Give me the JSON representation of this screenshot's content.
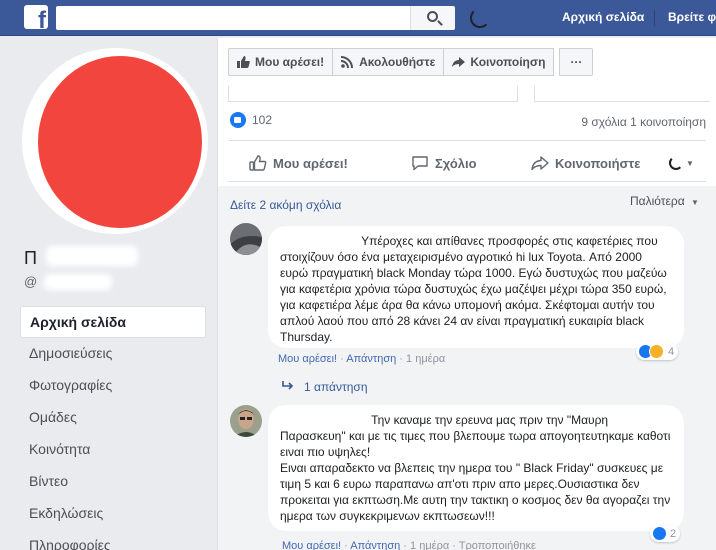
{
  "topbar": {
    "logo": "f",
    "nav_home": "Αρχική σελίδα",
    "nav_find": "Βρείτε φίλους",
    "colors": {
      "bar": "#3b5998",
      "accent": "#4267b2"
    },
    "icons": {
      "search": "search-icon",
      "logo": "facebook-logo-icon"
    }
  },
  "profile": {
    "name": "Π",
    "handle": "@",
    "avatar_color": "#f2453d"
  },
  "sidebar": {
    "items": [
      {
        "label": "Αρχική σελίδα",
        "active": true
      },
      {
        "label": "Δημοσιεύσεις"
      },
      {
        "label": "Φωτογραφίες"
      },
      {
        "label": "Ομάδες"
      },
      {
        "label": "Κοινότητα"
      },
      {
        "label": "Βίντεο"
      },
      {
        "label": "Εκδηλώσεις"
      },
      {
        "label": "Πληροφορίες"
      }
    ]
  },
  "page_actions": {
    "like": "Μου αρέσει!",
    "follow": "Ακολουθήστε",
    "share": "Κοινοποίηση",
    "more": "···"
  },
  "post": {
    "likes": "102",
    "stats": "9 σχόλια  1 κοινοποίηση",
    "like_btn": "Μου αρέσει!",
    "comment_btn": "Σχόλιο",
    "share_btn": "Κοινοποιήστε"
  },
  "comments_section": {
    "more_comments": "Δείτε 2 ακόμη σχόλια",
    "sort": "Παλιότερα",
    "reply_link": "1 απάντηση"
  },
  "comments": [
    {
      "text": "Υπέροχες και απίθανες προσφορές στις καφετέριες που στοιχίζουν όσο ένα μεταχειρισμένο αγροτικό hi lux Toyota. Από 2000 ευρώ πραγματική black Monday τώρα 1000. Εγώ δυστυχώς που μαζεύω για καφετέρια χρόνια τώρα δυστυχώς έχω μαζέψει μέχρι τώρα 350 ευρώ, για καφετιέρα λέμε άρα θα κάνω υπομονή ακόμα. Σκέφτομαι αυτήν του απλού λαού που από 28 κάνει 24 αν είναι πραγματική ευκαιρία black Thursday.",
      "like": "Μου αρέσει!",
      "reply": "Απάντηση",
      "time": "1 ημέρα",
      "reactions": "4"
    },
    {
      "text": "Την καναμε την ερευνα μας πριν την \"Μαυρη Παρασκευη\" και με τις τιμες που βλεπουμε τωρα απογοητευτηκαμε καθοτι ειναι πιο υψηλες!\nΕιναι απαραδεκτο να βλεπεις την ημερα του \" Black Friday\" συσκευες με τιμη 5 και 6 ευρω παραπανω απ'οτι πριν απο μερες.Ουσιαστικα δεν προκειται για εκπτωση.Με αυτη την τακτικη ο κοσμος δεν θα αγοραζει την ημερα των συγκεκριμενων εκπτωσεων!!!",
      "like": "Μου αρέσει!",
      "reply": "Απάντηση",
      "time": "1 ημέρα",
      "edited": "Τροποποιήθηκε",
      "reactions": "2"
    }
  ]
}
